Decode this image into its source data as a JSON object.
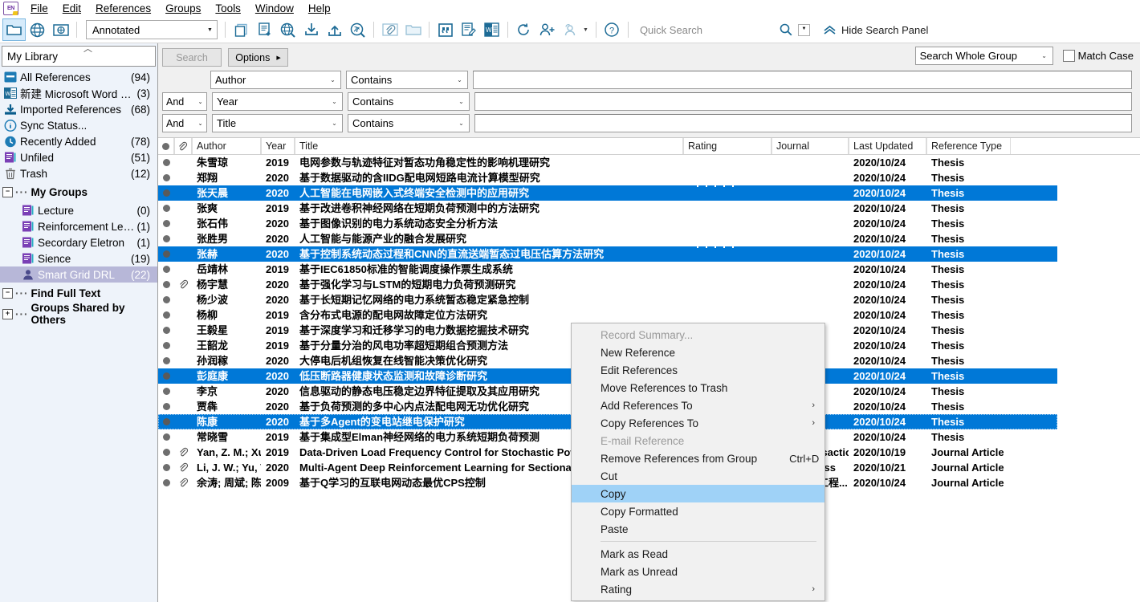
{
  "menubar": {
    "items": [
      "File",
      "Edit",
      "References",
      "Groups",
      "Tools",
      "Window",
      "Help"
    ],
    "logo_text": "EN"
  },
  "toolbar": {
    "style": "Annotated",
    "quick_search_placeholder": "Quick Search",
    "hide_search_panel": "Hide Search Panel",
    "icons": [
      "folder-icon",
      "globe-icon",
      "online-folder-icon",
      "copy-icon",
      "new-reference-icon",
      "online-search-icon",
      "import-icon",
      "export-icon",
      "find-fulltext-icon",
      "attach-file-icon",
      "open-folder-icon",
      "quote-icon",
      "edit-reference-icon",
      "word-icon",
      "sync-icon",
      "share-library-icon",
      "manuscript-matcher-icon",
      "help-icon"
    ]
  },
  "search_panel": {
    "search_button": "Search",
    "options_button": "Options",
    "scope": "Search Whole Group",
    "match_case": "Match Case",
    "rows": [
      {
        "bool": "",
        "field": "Author",
        "operator": "Contains",
        "value": ""
      },
      {
        "bool": "And",
        "field": "Year",
        "operator": "Contains",
        "value": ""
      },
      {
        "bool": "And",
        "field": "Title",
        "operator": "Contains",
        "value": ""
      }
    ]
  },
  "sidebar": {
    "library_name": "My Library",
    "items": [
      {
        "icon": "all-references-icon",
        "label": "All References",
        "count": "(94)"
      },
      {
        "icon": "word-doc-icon",
        "label": "新建 Microsoft Word 文...",
        "count": "(3)"
      },
      {
        "icon": "imported-references-icon",
        "label": "Imported References",
        "count": "(68)"
      },
      {
        "icon": "sync-status-icon",
        "label": "Sync Status...",
        "count": ""
      },
      {
        "icon": "recently-added-icon",
        "label": "Recently Added",
        "count": "(78)"
      },
      {
        "icon": "unfiled-icon",
        "label": "Unfiled",
        "count": "(51)"
      },
      {
        "icon": "trash-icon",
        "label": "Trash",
        "count": "(12)"
      }
    ],
    "my_groups_label": "My Groups",
    "groups": [
      {
        "icon": "group-icon",
        "label": "Lecture",
        "count": "(0)",
        "selected": false
      },
      {
        "icon": "group-icon",
        "label": "Reinforcement Learing",
        "count": "(1)",
        "selected": false
      },
      {
        "icon": "group-icon",
        "label": "Secordary Eletron",
        "count": "(1)",
        "selected": false
      },
      {
        "icon": "group-icon",
        "label": "Sience",
        "count": "(19)",
        "selected": false
      },
      {
        "icon": "shared-group-icon",
        "label": "Smart Grid DRL",
        "count": "(22)",
        "selected": true
      }
    ],
    "find_full_text_label": "Find Full Text",
    "groups_shared_label": "Groups Shared by Others"
  },
  "table": {
    "columns": [
      {
        "key": "read",
        "label": "",
        "icon": "read-status-icon"
      },
      {
        "key": "clip",
        "label": "",
        "icon": "paperclip-icon"
      },
      {
        "key": "author",
        "label": "Author"
      },
      {
        "key": "year",
        "label": "Year"
      },
      {
        "key": "title",
        "label": "Title"
      },
      {
        "key": "rating",
        "label": "Rating"
      },
      {
        "key": "journal",
        "label": "Journal"
      },
      {
        "key": "updated",
        "label": "Last Updated"
      },
      {
        "key": "type",
        "label": "Reference Type"
      }
    ],
    "rows": [
      {
        "clip": false,
        "author": "朱雪琼",
        "year": "2019",
        "title": "电网参数与轨迹特征对暂态功角稳定性的影响机理研究",
        "rating": 0,
        "journal": "",
        "updated": "2020/10/24",
        "type": "Thesis",
        "selected": false,
        "focus": false
      },
      {
        "clip": false,
        "author": "郑翔",
        "year": "2020",
        "title": "基于数据驱动的含IIDG配电网短路电流计算模型研究",
        "rating": 0,
        "journal": "",
        "updated": "2020/10/24",
        "type": "Thesis",
        "selected": false,
        "focus": false
      },
      {
        "clip": false,
        "author": "张天晨",
        "year": "2020",
        "title": "人工智能在电网嵌入式终端安全检测中的应用研究",
        "rating": 5,
        "journal": "",
        "updated": "2020/10/24",
        "type": "Thesis",
        "selected": true,
        "focus": false
      },
      {
        "clip": false,
        "author": "张爽",
        "year": "2019",
        "title": "基于改进卷积神经网络在短期负荷预测中的方法研究",
        "rating": 0,
        "journal": "",
        "updated": "2020/10/24",
        "type": "Thesis",
        "selected": false,
        "focus": false
      },
      {
        "clip": false,
        "author": "张石伟",
        "year": "2020",
        "title": "基于图像识别的电力系统动态安全分析方法",
        "rating": 0,
        "journal": "",
        "updated": "2020/10/24",
        "type": "Thesis",
        "selected": false,
        "focus": false
      },
      {
        "clip": false,
        "author": "张胜男",
        "year": "2020",
        "title": "人工智能与能源产业的融合发展研究",
        "rating": 0,
        "journal": "",
        "updated": "2020/10/24",
        "type": "Thesis",
        "selected": false,
        "focus": false
      },
      {
        "clip": false,
        "author": "张赫",
        "year": "2020",
        "title": "基于控制系统动态过程和CNN的直流送端暂态过电压估算方法研究",
        "rating": 5,
        "journal": "",
        "updated": "2020/10/24",
        "type": "Thesis",
        "selected": true,
        "focus": false
      },
      {
        "clip": false,
        "author": "岳靖林",
        "year": "2019",
        "title": "基于IEC61850标准的智能调度操作票生成系统",
        "rating": 0,
        "journal": "",
        "updated": "2020/10/24",
        "type": "Thesis",
        "selected": false,
        "focus": false
      },
      {
        "clip": true,
        "author": "杨宇慧",
        "year": "2020",
        "title": "基于强化学习与LSTM的短期电力负荷预测研究",
        "rating": 0,
        "journal": "",
        "updated": "2020/10/24",
        "type": "Thesis",
        "selected": false,
        "focus": false
      },
      {
        "clip": false,
        "author": "杨少波",
        "year": "2020",
        "title": "基于长短期记忆网络的电力系统暂态稳定紧急控制",
        "rating": 0,
        "journal": "",
        "updated": "2020/10/24",
        "type": "Thesis",
        "selected": false,
        "focus": false
      },
      {
        "clip": false,
        "author": "杨柳",
        "year": "2019",
        "title": "含分布式电源的配电网故障定位方法研究",
        "rating": 0,
        "journal": "",
        "updated": "2020/10/24",
        "type": "Thesis",
        "selected": false,
        "focus": false
      },
      {
        "clip": false,
        "author": "王毅星",
        "year": "2019",
        "title": "基于深度学习和迁移学习的电力数据挖掘技术研究",
        "rating": 0,
        "journal": "",
        "updated": "2020/10/24",
        "type": "Thesis",
        "selected": false,
        "focus": false
      },
      {
        "clip": false,
        "author": "王韶龙",
        "year": "2019",
        "title": "基于分量分治的风电功率超短期组合预测方法",
        "rating": 0,
        "journal": "",
        "updated": "2020/10/24",
        "type": "Thesis",
        "selected": false,
        "focus": false
      },
      {
        "clip": false,
        "author": "孙润稼",
        "year": "2020",
        "title": "大停电后机组恢复在线智能决策优化研究",
        "rating": 0,
        "journal": "",
        "updated": "2020/10/24",
        "type": "Thesis",
        "selected": false,
        "focus": false
      },
      {
        "clip": false,
        "author": "彭庭康",
        "year": "2020",
        "title": "低压断路器健康状态监测和故障诊断研究",
        "rating": 0,
        "journal": "",
        "updated": "2020/10/24",
        "type": "Thesis",
        "selected": true,
        "focus": false
      },
      {
        "clip": false,
        "author": "李京",
        "year": "2020",
        "title": "信息驱动的静态电压稳定边界特征提取及其应用研究",
        "rating": 0,
        "journal": "",
        "updated": "2020/10/24",
        "type": "Thesis",
        "selected": false,
        "focus": false
      },
      {
        "clip": false,
        "author": "贾犇",
        "year": "2020",
        "title": "基于负荷预测的多中心内点法配电网无功优化研究",
        "rating": 0,
        "journal": "",
        "updated": "2020/10/24",
        "type": "Thesis",
        "selected": false,
        "focus": false
      },
      {
        "clip": false,
        "author": "陈康",
        "year": "2020",
        "title": "基于多Agent的变电站继电保护研究",
        "rating": 0,
        "journal": "",
        "updated": "2020/10/24",
        "type": "Thesis",
        "selected": true,
        "focus": true
      },
      {
        "clip": false,
        "author": "常晓雪",
        "year": "2019",
        "title": "基于集成型Elman神经网络的电力系统短期负荷预测",
        "rating": 0,
        "journal": "",
        "updated": "2020/10/24",
        "type": "Thesis",
        "selected": false,
        "focus": false
      },
      {
        "clip": true,
        "author": "Yan, Z. M.; Xu, Y.",
        "year": "2019",
        "title": "Data-Driven Load Frequency Control for Stochastic Power Systems",
        "rating": 0,
        "journal": "Ieee Transactio...",
        "updated": "2020/10/19",
        "type": "Journal Article",
        "selected": false,
        "focus": false
      },
      {
        "clip": true,
        "author": "Li, J. W.; Yu, T.; Zh...",
        "year": "2020",
        "title": "Multi-Agent Deep Reinforcement Learning for Sectional AGC Dispatch",
        "rating": 0,
        "journal": "Ieee Access",
        "updated": "2020/10/21",
        "type": "Journal Article",
        "selected": false,
        "focus": false
      },
      {
        "clip": true,
        "author": "余涛; 周斌; 陈家...",
        "year": "2009",
        "title": "基于Q学习的互联电网动态最优CPS控制",
        "rating": 0,
        "journal": "中国电机工程...",
        "updated": "2020/10/24",
        "type": "Journal Article",
        "selected": false,
        "focus": false
      }
    ]
  },
  "context_menu": {
    "items": [
      {
        "label": "Record Summary...",
        "disabled": true,
        "submenu": false,
        "accel": "",
        "highlight": false
      },
      {
        "label": "New Reference",
        "disabled": false,
        "submenu": false,
        "accel": "",
        "highlight": false
      },
      {
        "label": "Edit References",
        "disabled": false,
        "submenu": false,
        "accel": "",
        "highlight": false
      },
      {
        "label": "Move References to Trash",
        "disabled": false,
        "submenu": false,
        "accel": "",
        "highlight": false
      },
      {
        "label": "Add References To",
        "disabled": false,
        "submenu": true,
        "accel": "",
        "highlight": false
      },
      {
        "label": "Copy References To",
        "disabled": false,
        "submenu": true,
        "accel": "",
        "highlight": false
      },
      {
        "label": "E-mail Reference",
        "disabled": true,
        "submenu": false,
        "accel": "",
        "highlight": false
      },
      {
        "label": "Remove References from Group",
        "disabled": false,
        "submenu": false,
        "accel": "Ctrl+D",
        "highlight": false
      },
      {
        "label": "Cut",
        "disabled": false,
        "submenu": false,
        "accel": "",
        "highlight": false
      },
      {
        "label": "Copy",
        "disabled": false,
        "submenu": false,
        "accel": "",
        "highlight": true
      },
      {
        "label": "Copy Formatted",
        "disabled": false,
        "submenu": false,
        "accel": "",
        "highlight": false
      },
      {
        "label": "Paste",
        "disabled": false,
        "submenu": false,
        "accel": "",
        "highlight": false
      },
      {
        "separator": true
      },
      {
        "label": "Mark as Read",
        "disabled": false,
        "submenu": false,
        "accel": "",
        "highlight": false
      },
      {
        "label": "Mark as Unread",
        "disabled": false,
        "submenu": false,
        "accel": "",
        "highlight": false
      },
      {
        "label": "Rating",
        "disabled": false,
        "submenu": true,
        "accel": "",
        "highlight": false
      }
    ]
  },
  "colors": {
    "selection_blue": "#0078d7",
    "menu_highlight": "#9fd2f7",
    "sidebar_bg": "#eef3fa",
    "sidebar_selected": "#b7b7d8",
    "accent_teal": "#1d6b96",
    "group_purple": "#7a3fb5"
  }
}
